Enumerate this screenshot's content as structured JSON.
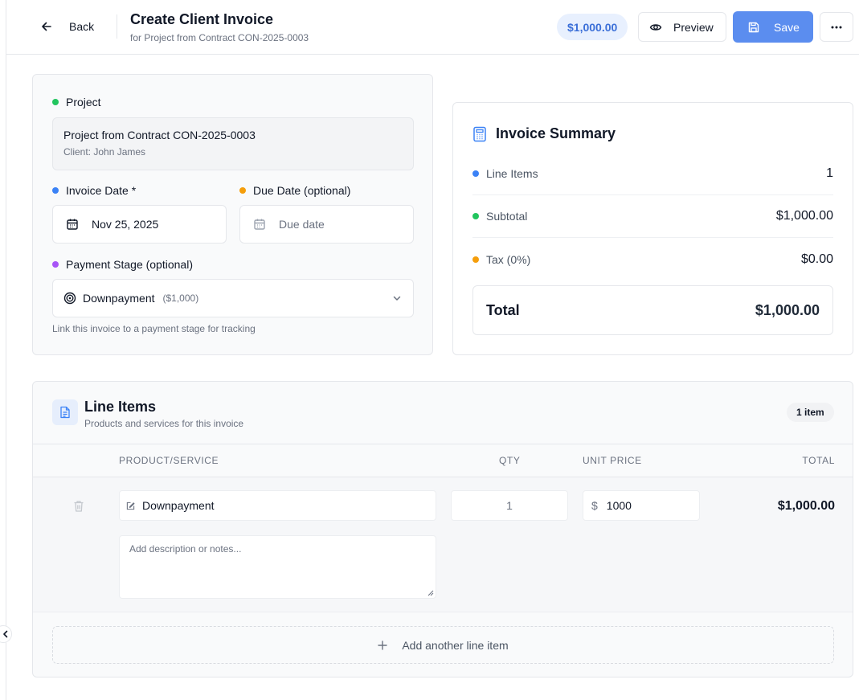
{
  "header": {
    "back_label": "Back",
    "title": "Create Client Invoice",
    "subtitle": "for Project from Contract CON-2025-0003",
    "amount": "$1,000.00",
    "preview_label": "Preview",
    "save_label": "Save"
  },
  "project": {
    "label": "Project",
    "name": "Project from Contract CON-2025-0003",
    "client": "Client: John James",
    "invoice_date_label": "Invoice Date *",
    "invoice_date_value": "Nov 25, 2025",
    "due_date_label": "Due Date (optional)",
    "due_date_placeholder": "Due date",
    "payment_stage_label": "Payment Stage (optional)",
    "payment_stage_value": "Downpayment",
    "payment_stage_amount": "($1,000)",
    "payment_stage_hint": "Link this invoice to a payment stage for tracking"
  },
  "summary": {
    "title": "Invoice Summary",
    "rows": [
      {
        "label": "Line Items",
        "value": "1"
      },
      {
        "label": "Subtotal",
        "value": "$1,000.00"
      },
      {
        "label": "Tax (0%)",
        "value": "$0.00"
      }
    ],
    "total_label": "Total",
    "total_value": "$1,000.00"
  },
  "line_items": {
    "title": "Line Items",
    "subtitle": "Products and services for this invoice",
    "count_badge": "1 item",
    "columns": [
      "PRODUCT/SERVICE",
      "QTY",
      "UNIT PRICE",
      "TOTAL"
    ],
    "rows": [
      {
        "product": "Downpayment",
        "qty": "1",
        "currency_symbol": "$",
        "unit_price": "1000",
        "total": "$1,000.00",
        "notes_placeholder": "Add description or notes..."
      }
    ],
    "add_label": "Add another line item"
  },
  "colors": {
    "accent": "#5b8def",
    "dot_green": "#22c55e",
    "dot_blue": "#3b82f6",
    "dot_orange": "#f59e0b",
    "dot_purple": "#a855f7"
  },
  "icons": {
    "back": "arrow-left-icon",
    "preview": "eye-icon",
    "save": "floppy-disk-icon",
    "more": "more-horizontal-icon",
    "calendar": "calendar-icon",
    "target": "target-icon",
    "chevron": "chevron-down-icon",
    "calculator": "calculator-icon",
    "document": "document-icon",
    "trash": "trash-icon",
    "edit": "edit-icon",
    "plus": "plus-icon",
    "collapse": "chevron-left-icon"
  }
}
